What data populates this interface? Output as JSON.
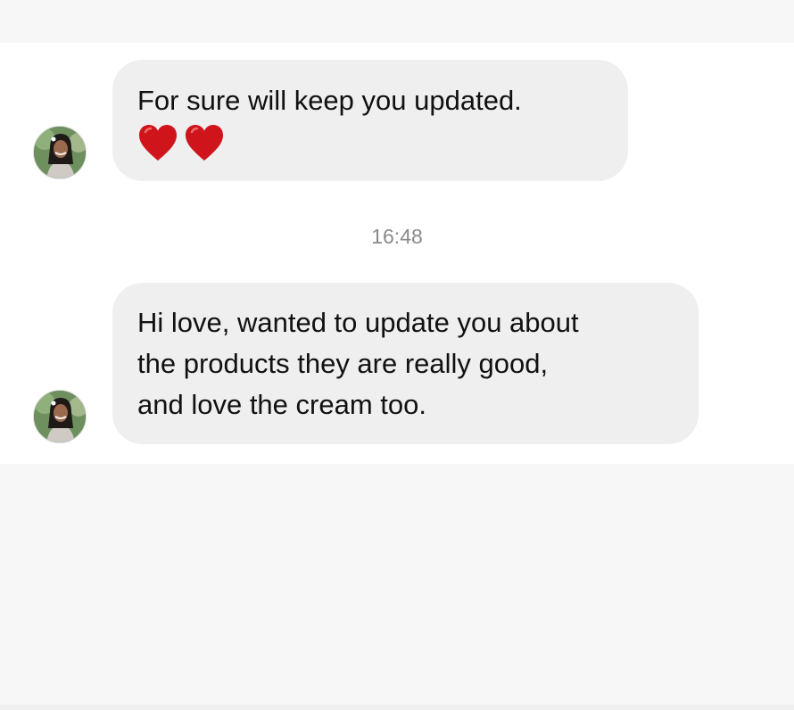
{
  "thread": {
    "messages": [
      {
        "lines": [
          "For sure will keep you updated."
        ],
        "emoji": "heart-emoji",
        "emoji_count": 2
      },
      {
        "lines": [
          "Hi love, wanted to update you about",
          "the products they are really good,",
          "and love the cream too."
        ]
      }
    ],
    "timestamp": "16:48"
  },
  "colors": {
    "bubble": "#efefef",
    "heart": "#d0141c",
    "timestamp": "#8a8a8a"
  }
}
